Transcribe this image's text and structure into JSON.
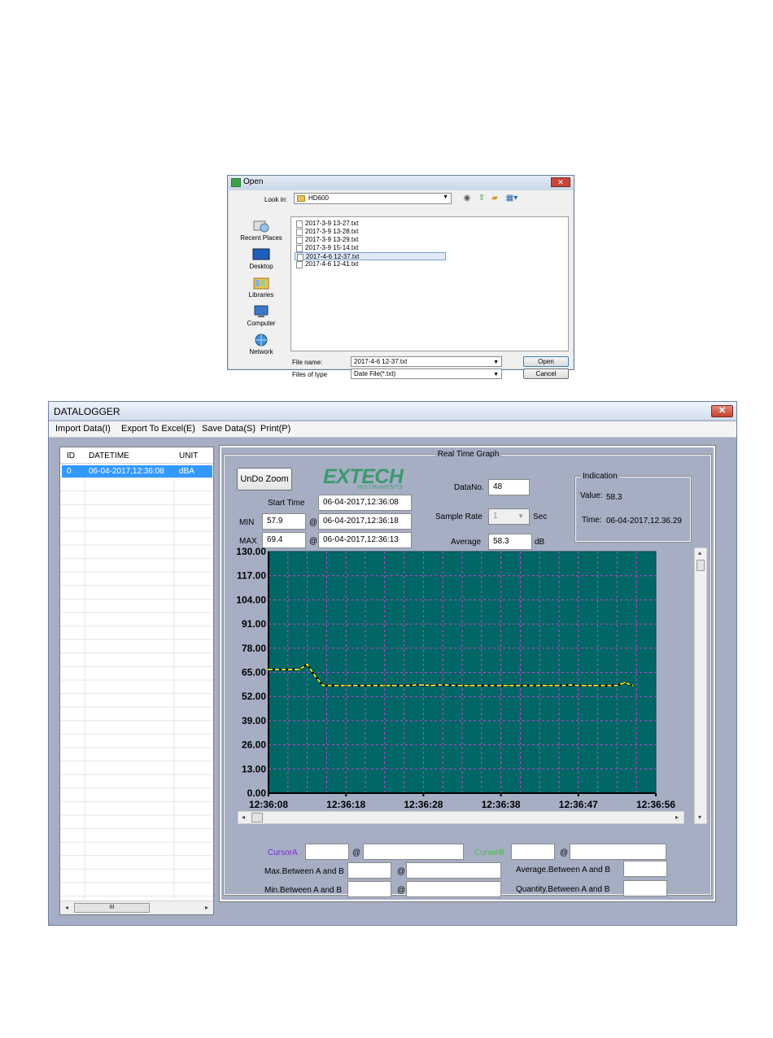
{
  "open_dialog": {
    "title": "Open",
    "close_glyph": "✕",
    "look_in_label": "Look in:",
    "look_in_value": "HD600",
    "places": [
      "Recent Places",
      "Desktop",
      "Libraries",
      "Computer",
      "Network"
    ],
    "files": [
      "2017-3-9 13-27.txt",
      "2017-3-9 13-28.txt",
      "2017-3-9 13-29.txt",
      "2017-3-9 15-14.txt",
      "2017-4-6 12-37.txt",
      "2017-4-6 12-41.txt"
    ],
    "selected_file_index": 4,
    "file_name_label": "File name:",
    "file_name_value": "2017-4-6 12-37.txt",
    "file_type_label": "Files of type",
    "file_type_value": "Date File(*.txt)",
    "open_button": "Open",
    "cancel_button": "Cancel"
  },
  "app": {
    "title": "DATALOGGER",
    "close_glyph": "✕",
    "menu": [
      "Import Data(I)",
      "Export To Excel(E)",
      "Save Data(S)",
      "Print(P)"
    ],
    "table": {
      "headers": [
        "ID",
        "DATETIME",
        "UNIT"
      ],
      "rows": [
        {
          "id": "0",
          "datetime": "06-04-2017,12:36:08",
          "unit": "dBA"
        }
      ]
    },
    "graph_title": "Real Time Graph",
    "undo_zoom": "UnDo Zoom",
    "logo": {
      "main": "EXTECH",
      "sub": "INSTRUMENTS"
    },
    "start_time_label": "Start Time",
    "start_time_value": "06-04-2017,12:36:08",
    "min_label": "MIN",
    "min_value": "57.9",
    "min_at": "@",
    "min_time": "06-04-2017,12:36:18",
    "max_label": "MAX",
    "max_value": "69.4",
    "max_at": "@",
    "max_time": "06-04-2017,12:36:13",
    "datano_label": "DataNo.",
    "datano_value": "48",
    "sample_rate_label": "Sample Rate",
    "sample_rate_value": "1",
    "sample_rate_unit": "Sec",
    "average_label": "Average",
    "average_value": "58.3",
    "average_unit": "dB",
    "indication": {
      "legend": "Indication",
      "value_label": "Value:",
      "value": "58.3",
      "time_label": "Time:",
      "time": "06-04-2017,12.36.29"
    },
    "cursor_a_label": "CursorA",
    "cursor_b_label": "CursorB",
    "at_symbol": "@",
    "max_between_label": "Max.Between A and B",
    "min_between_label": "Min.Between A and B",
    "avg_between_label": "Average.Between A and B",
    "qty_between_label": "Quantity.Between A and B",
    "scroll_thumb_glyph": "III",
    "colors": {
      "plot_background": "#006666",
      "grid": "#cc44cc",
      "line": "#ffff33",
      "selection": "#3399ff"
    }
  },
  "chart_data": {
    "type": "line",
    "title": "",
    "xlabel": "",
    "ylabel": "",
    "ylim": [
      0,
      130
    ],
    "yticks": [
      "130.00",
      "117.00",
      "104.00",
      "91.00",
      "78.00",
      "65.00",
      "52.00",
      "39.00",
      "26.00",
      "13.00",
      "0.00"
    ],
    "xticks": [
      "12:36:08",
      "12:36:18",
      "12:36:28",
      "12:36:38",
      "12:36:47",
      "12:36:56"
    ],
    "xlim": [
      0,
      50
    ],
    "grid": true,
    "series": [
      {
        "x": [
          0,
          1,
          2,
          3,
          4,
          5,
          6,
          7,
          8,
          9,
          10,
          11,
          12,
          13,
          14,
          15,
          16,
          17,
          18,
          19,
          20,
          21,
          22,
          23,
          24,
          25,
          26,
          27,
          28,
          29,
          30,
          31,
          32,
          33,
          34,
          35,
          36,
          37,
          38,
          39,
          40,
          41,
          42,
          43,
          44,
          45,
          46,
          47
        ],
        "values": [
          66.5,
          66.5,
          66.5,
          66.5,
          66.5,
          69.4,
          63.0,
          58.0,
          57.9,
          57.9,
          57.9,
          57.9,
          57.9,
          57.9,
          57.9,
          57.9,
          57.9,
          57.9,
          57.9,
          58.2,
          58.2,
          57.9,
          58.2,
          58.2,
          57.9,
          57.9,
          57.9,
          57.9,
          57.9,
          57.9,
          57.9,
          57.9,
          57.9,
          57.9,
          57.9,
          57.9,
          57.9,
          57.9,
          57.9,
          58.2,
          57.9,
          57.9,
          57.9,
          57.9,
          57.9,
          57.9,
          59.5,
          58.0
        ]
      }
    ]
  }
}
